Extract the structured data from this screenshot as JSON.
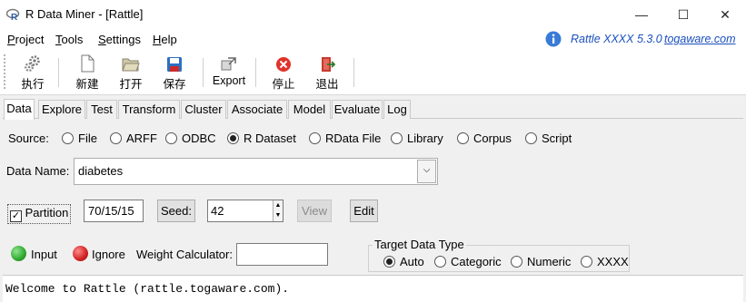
{
  "window": {
    "title": "R Data Miner - [Rattle]",
    "controls": {
      "minimize": "—",
      "maximize": "☐",
      "close": "✕"
    }
  },
  "menu": {
    "items": [
      {
        "label": "Project",
        "mnemonic": "P",
        "rest": "roject"
      },
      {
        "label": "Tools",
        "mnemonic": "T",
        "rest": "ools"
      },
      {
        "label": "Settings",
        "mnemonic": "S",
        "rest": "ettings"
      },
      {
        "label": "Help",
        "mnemonic": "H",
        "rest": "elp"
      }
    ],
    "version_text": "Rattle XXXX 5.3.0",
    "site_link": "togaware.com"
  },
  "toolbar": {
    "execute": "执行",
    "new": "新建",
    "open": "打开",
    "save": "保存",
    "export": "Export",
    "stop": "停止",
    "quit": "退出"
  },
  "tabs": [
    "Data",
    "Explore",
    "Test",
    "Transform",
    "Cluster",
    "Associate",
    "Model",
    "Evaluate",
    "Log"
  ],
  "active_tab": "Data",
  "source": {
    "label": "Source:",
    "options": [
      "File",
      "ARFF",
      "ODBC",
      "R Dataset",
      "RData File",
      "Library",
      "Corpus",
      "Script"
    ],
    "selected": "R Dataset"
  },
  "data_name": {
    "label": "Data Name:",
    "value": "diabetes"
  },
  "partition": {
    "label": "Partition",
    "checked": true,
    "value": "70/15/15",
    "seed_label": "Seed:",
    "seed_value": "42",
    "view_label": "View",
    "edit_label": "Edit"
  },
  "roles": {
    "input_label": "Input",
    "ignore_label": "Ignore",
    "weight_label": "Weight Calculator:",
    "weight_value": "",
    "input_color": "#2fa82f",
    "ignore_color": "#d02020"
  },
  "target": {
    "legend": "Target Data Type",
    "options": [
      "Auto",
      "Categoric",
      "Numeric",
      "XXXX"
    ],
    "selected": "Auto"
  },
  "log": {
    "text": "Welcome to Rattle (rattle.togaware.com)."
  },
  "colors": {
    "link": "#1a4fbf",
    "info_icon": "#3a7bd5"
  }
}
